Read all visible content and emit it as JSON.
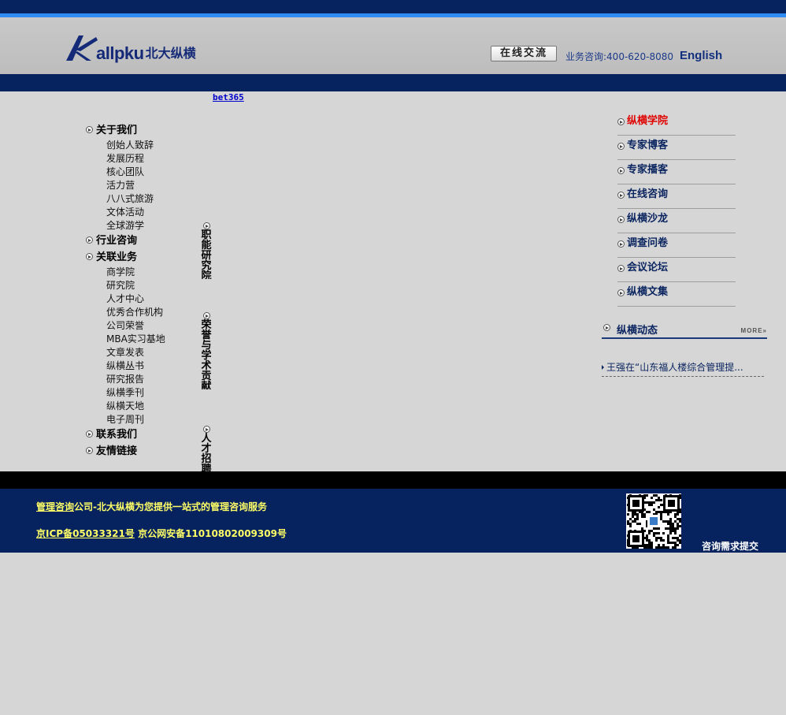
{
  "header": {
    "logo_text": "allpku",
    "logo_cn": "北大纵横",
    "chat_button": "在线交流",
    "hotline": "业务咨询:400-620-8080",
    "english": "English"
  },
  "top_link": "bet365",
  "left_nav": [
    {
      "label": "关于我们",
      "children": [
        "创始人致辞",
        "发展历程",
        "核心团队",
        "活力营",
        "八八式旅游",
        "文体活动",
        "全球游学"
      ]
    },
    {
      "label": "行业咨询",
      "children": []
    },
    {
      "label": "关联业务",
      "children": [
        "商学院",
        "研究院",
        "人才中心",
        "优秀合作机构",
        "公司荣誉",
        "MBA实习基地",
        "文章发表",
        "纵横丛书",
        "研究报告",
        "纵横季刊",
        "纵横天地",
        "电子周刊"
      ]
    },
    {
      "label": "联系我们",
      "children": []
    },
    {
      "label": "友情链接",
      "children": []
    }
  ],
  "vertical_nav": [
    "职能研究院",
    "荣誉与学术贡献",
    "人才招聘"
  ],
  "right_nav": [
    "纵横学院",
    "专家博客",
    "专家播客",
    "在线咨询",
    "纵横沙龙",
    "调查问卷",
    "会议论坛",
    "纵横文集"
  ],
  "dynamics": {
    "title": "纵横动态",
    "more": "MORE»",
    "news": [
      "王强在“山东福人楼综合管理提..."
    ]
  },
  "footer": {
    "line1_link": "管理咨询",
    "line1_rest": "公司-北大纵横为您提供一站式的管理咨询服务",
    "icp": "京ICP备05033321号",
    "police": "京公网安备11010802009309号",
    "submit": "咨询需求提交"
  },
  "colors": {
    "navy": "#06225f",
    "accent_blue": "#2f8cf2",
    "active_red": "#e00000",
    "footer_text": "#ffff66"
  }
}
